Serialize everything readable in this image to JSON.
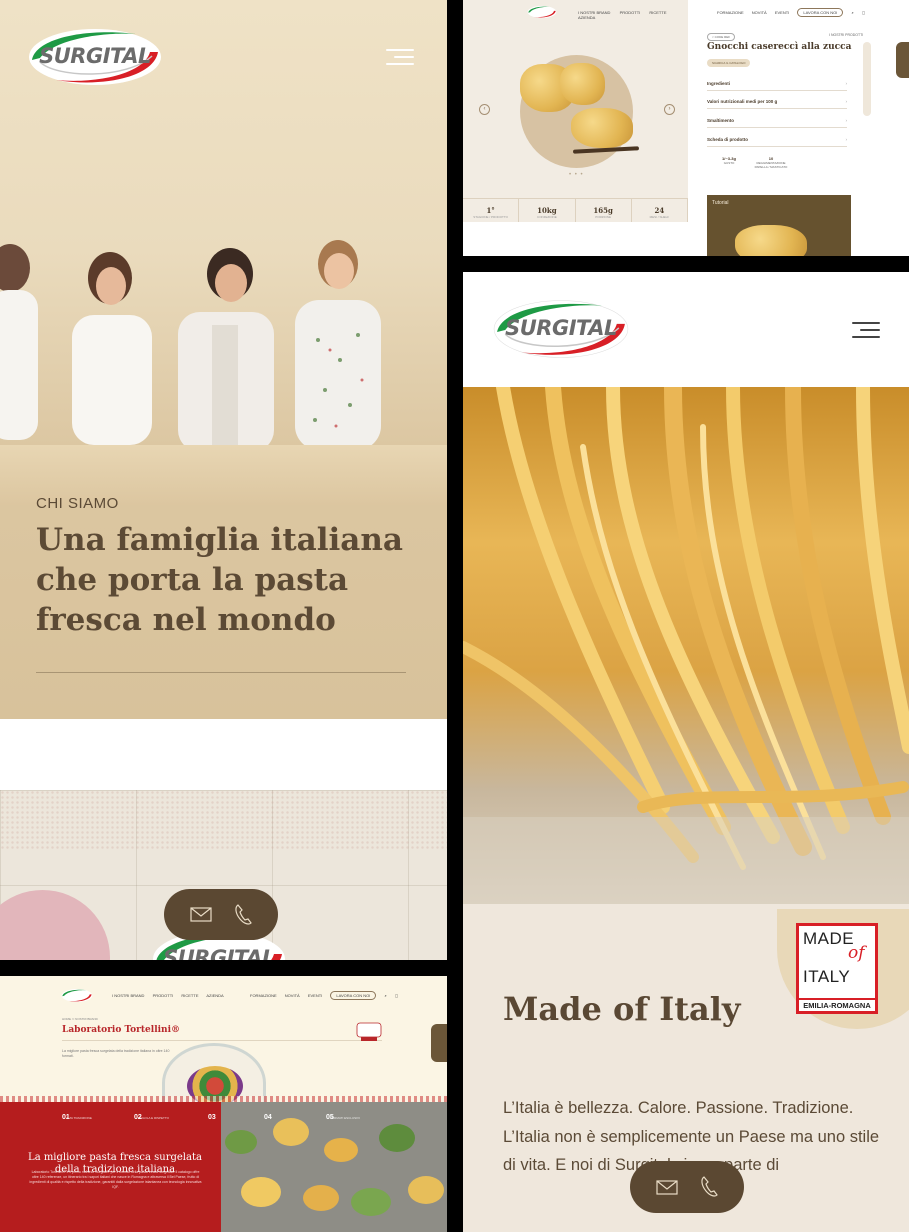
{
  "brand": {
    "logo_text": "SURGITAL",
    "red": "#d81f26",
    "green": "#1e9a45",
    "brown": "#5b4832"
  },
  "chi_siamo": {
    "kicker": "CHI SIAMO",
    "headline": "Una famiglia italiana che porta la pasta fresca nel mondo",
    "menu_icon": "hamburger-menu-icon",
    "contact": {
      "mail_icon": "mail-icon",
      "phone_icon": "phone-icon"
    }
  },
  "product": {
    "nav_left": [
      "I NOSTRI BRAND",
      "PRODOTTI",
      "RICETTE",
      "AZIENDA"
    ],
    "nav_right": [
      "FORMAZIONE",
      "NOVITÀ",
      "EVENTI"
    ],
    "nav_cta": "LAVORA CON NOI",
    "chip": "< CODE REF",
    "crumb_right": "I NOSTRI PRODOTTI",
    "title": "Gnocchi casereccì alla zucca",
    "download": "SCARICA IL CATALOGO",
    "accordion": [
      "Ingredienti",
      "Valori nutrizionali medi per 100 g",
      "Smaltimento",
      "Scheda di prodotto"
    ],
    "mini": [
      {
        "value": "1/~3-3g",
        "label": "GUSTO"
      },
      {
        "value": "10",
        "label": "REGGIMENTAZIONE PAPELLA / MASTICATO"
      }
    ],
    "tutorial": "Tutorial",
    "stats": [
      {
        "value": "1°",
        "label": "STAGIONE / PRODOTTO"
      },
      {
        "value": "10kg",
        "label": "CONFEZIONE"
      },
      {
        "value": "165g",
        "label": "PORZIONE"
      },
      {
        "value": "24",
        "label": "MESI / SHELF"
      }
    ],
    "carousel_dots": "• • •"
  },
  "made_of_italy": {
    "badge": {
      "line1": "MADE",
      "of": "of",
      "line2": "ITALY",
      "region": "EMILIA-ROMAGNA"
    },
    "title": "Made of Italy",
    "body": "L’Italia è bellezza. Calore. Passione. Tradizione. L’Italia non è semplicemente un Paese ma uno stile di vita. E noi di Surgital siamo parte di"
  },
  "laboratorio": {
    "nav_left": [
      "I NOSTRI BRAND",
      "PRODOTTI",
      "RICETTE",
      "AZIENDA"
    ],
    "nav_right": [
      "FORMAZIONE",
      "NOVITÀ",
      "EVENTI"
    ],
    "nav_cta": "LAVORA CON NOI",
    "crumb": "HOME  /  I NOSTRI BRAND",
    "title": "Laboratorio Tortellini®",
    "subtitle": "La migliore pasta fresca surgelata della tradizione italiana in oltre 140 formati.",
    "steps": [
      {
        "n": "01",
        "label": "ALTA TRADIZIONE"
      },
      {
        "n": "02",
        "label": "REGOLA E RISPETTO"
      },
      {
        "n": "03",
        "label": ""
      },
      {
        "n": "04",
        "label": ""
      },
      {
        "n": "05",
        "label": "FORMATI ESCLUSIVI"
      }
    ],
    "red_title": "La migliore pasta fresca surgelata della tradizione italiana",
    "red_body": "Laboratorio Tortellini® è il primo marchio Surgital® per il mondo della pasta fresca surgelata. Il catalogo offre oltre 140 referenze, un itinerario tra i sapori italiani che nasce in Romagna e attraversa il Bel Paese, frutto di ingredienti di qualità e rispetto della tradizione, garantiti dalla surgelazione istantanea con tecnologia innovativa IQF."
  }
}
